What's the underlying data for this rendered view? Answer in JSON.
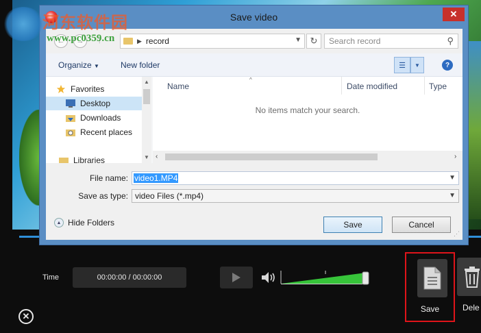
{
  "dialog": {
    "title": "Save video",
    "address": {
      "path": "record",
      "search_placeholder": "Search record"
    },
    "toolbar": {
      "organize": "Organize",
      "new_folder": "New folder"
    },
    "nav": [
      {
        "label": "Favorites",
        "icon": "star-icon"
      },
      {
        "label": "Desktop",
        "icon": "desktop-icon",
        "selected": true
      },
      {
        "label": "Downloads",
        "icon": "downloads-icon"
      },
      {
        "label": "Recent places",
        "icon": "recent-places-icon"
      },
      {
        "label": "Libraries",
        "icon": "libraries-icon"
      }
    ],
    "columns": {
      "name": "Name",
      "date_modified": "Date modified",
      "type": "Type"
    },
    "empty_message": "No items match your search.",
    "file_name_label": "File name:",
    "file_name_value": "video1.MP4",
    "save_type_label": "Save as type:",
    "save_type_value": "video Files (*.mp4)",
    "hide_folders": "Hide Folders",
    "save_button": "Save",
    "cancel_button": "Cancel"
  },
  "player": {
    "time_label": "Time",
    "time_value": "00:00:00 / 00:00:00",
    "save_tool_label": "Save",
    "delete_tool_label": "Dele"
  },
  "watermark": {
    "text_cn": "河东软件园",
    "url": "www.pc0359.cn"
  },
  "colors": {
    "accent": "#2f8fd8",
    "highlight_border": "#e0141a",
    "volume_fill": "#37c43a",
    "dialog_frame": "#5a8ec4"
  }
}
